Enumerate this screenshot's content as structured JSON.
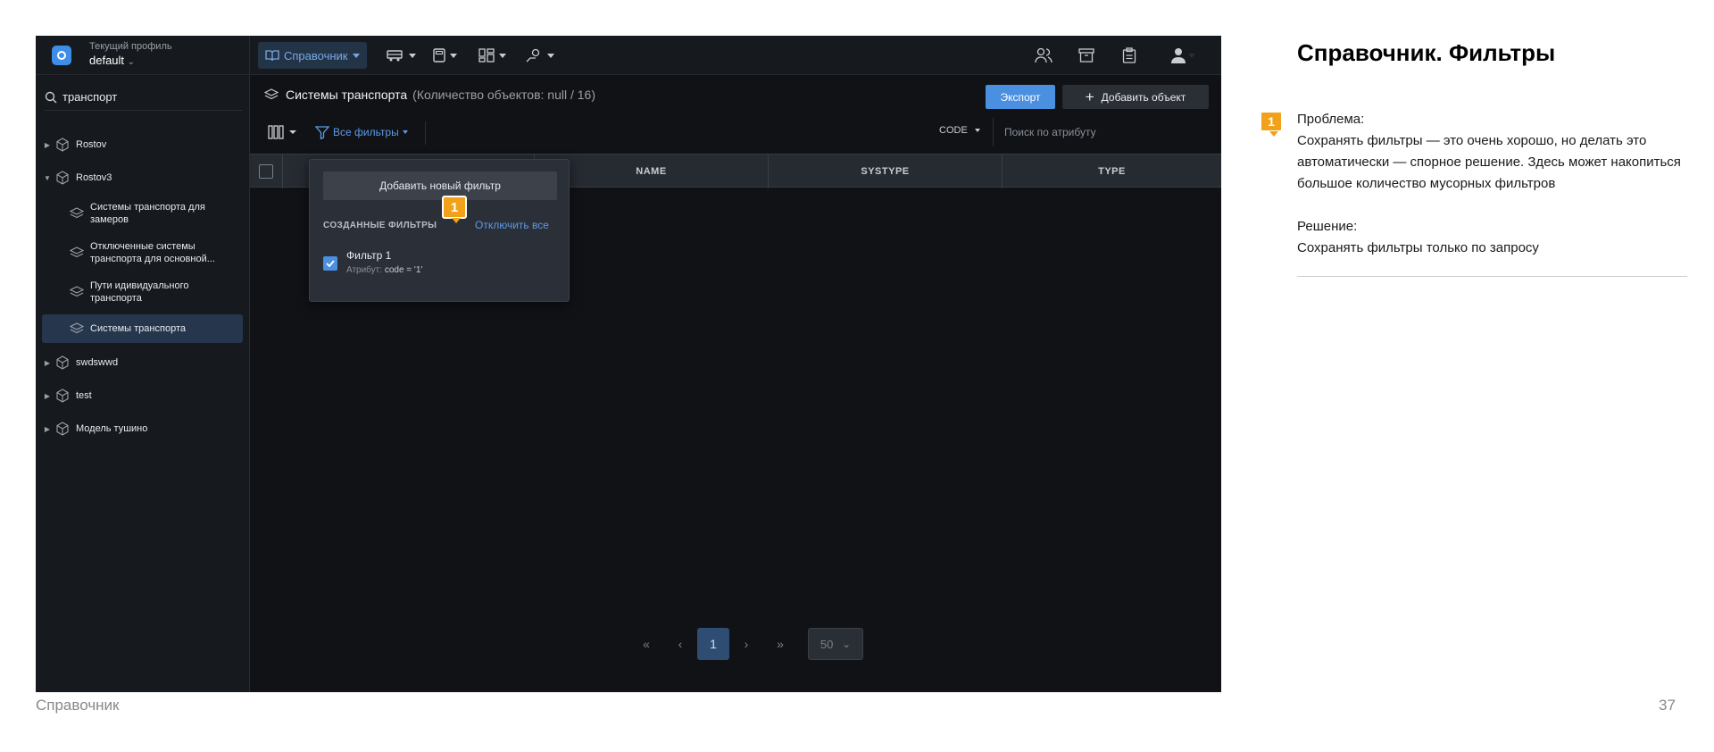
{
  "app": {
    "profile": {
      "caption": "Текущий профиль",
      "value": "default"
    },
    "toolbar": {
      "directory_label": "Справочник"
    },
    "search": {
      "value": "транспорт"
    },
    "tree": [
      {
        "label": "Rostov"
      },
      {
        "label": "Rostov3"
      },
      {
        "label": "Системы транспорта для замеров"
      },
      {
        "label": "Отключенные системы транспорта для основной..."
      },
      {
        "label": "Пути идивидуального транспорта"
      },
      {
        "label": "Системы транспорта"
      },
      {
        "label": "swdswwd"
      },
      {
        "label": "test"
      },
      {
        "label": "Модель тушино"
      }
    ],
    "main": {
      "title": "Системы транспорта",
      "count": "(Количество объектов: null / 16)",
      "export_label": "Экспорт",
      "add_label": "Добавить объект",
      "all_filters_label": "Все фильтры",
      "attribute_select": "CODE",
      "attribute_search_placeholder": "Поиск по атрибуту",
      "columns": [
        "NAME",
        "SYSTYPE",
        "TYPE"
      ]
    },
    "popover": {
      "add_filter_label": "Добавить новый фильтр",
      "created_caption": "СОЗДАННЫЕ ФИЛЬТРЫ",
      "disable_all_label": "Отключить все",
      "filters": [
        {
          "name": "Фильтр 1",
          "attr_prefix": "Атрибут:",
          "attr_value": "code = '1'",
          "checked": true
        }
      ]
    },
    "pagination": {
      "current": "1",
      "page_size": "50"
    },
    "marker": "1"
  },
  "slide": {
    "title": "Справочник. Фильтры",
    "marker": "1",
    "problem_heading": "Проблема:",
    "problem_text": "Сохранять фильтры — это очень хорошо, но делать это автоматически — спорное решение. Здесь может накопиться большое количество мусорных фильтров",
    "solution_heading": "Решение:",
    "solution_text": "Сохранять фильтры только по запросу",
    "footer_section": "Справочник",
    "page_number": "37"
  },
  "colors": {
    "accent": "#4a8fe0",
    "marker": "#f2a21a",
    "app_bg": "#101216"
  }
}
